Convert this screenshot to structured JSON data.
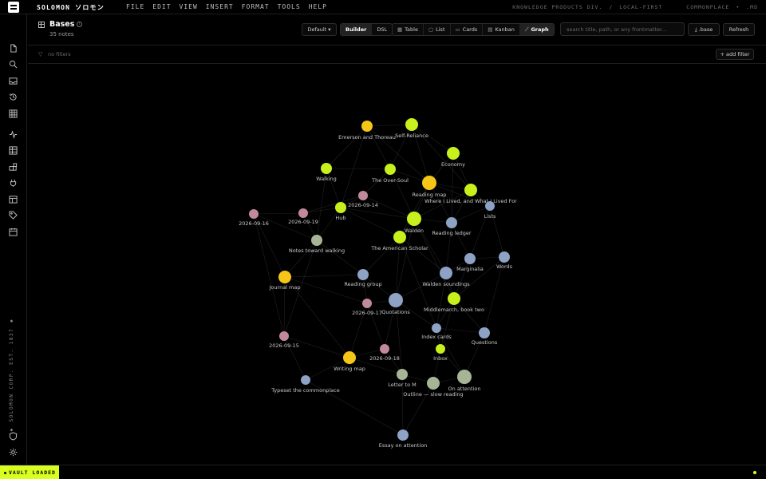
{
  "app": {
    "brand": "SOLOMON ソロモン",
    "menu": [
      "FILE",
      "EDIT",
      "VIEW",
      "INSERT",
      "FORMAT",
      "TOOLS",
      "HELP"
    ],
    "top_right": [
      "KNOWLEDGE PRODUCTS DIV.",
      "/",
      "LOCAL-FIRST",
      "COMMONPLACE",
      "•",
      ".MD"
    ],
    "rail_vertical_text": "◆ SOLOMON CORP. EST. 1837 ◆"
  },
  "rail_icons": [
    "file-icon",
    "search-icon",
    "inbox-icon",
    "history-icon",
    "grid-icon",
    "activity-icon",
    "table-icon",
    "blocks-icon",
    "plug-icon",
    "calendar-grid-icon",
    "tag-icon",
    "calendar-icon",
    "shield-icon",
    "gear-icon"
  ],
  "header": {
    "title": "Bases",
    "info_glyph": "i",
    "subtitle": "35 notes",
    "preset": "Default ▾",
    "mode_builder": "Builder",
    "mode_dsl": "DSL",
    "views": [
      {
        "glyph": "▦",
        "label": "Table"
      },
      {
        "glyph": "▢",
        "label": "List"
      },
      {
        "glyph": "▭",
        "label": "Cards"
      },
      {
        "glyph": "▤",
        "label": "Kanban"
      },
      {
        "glyph": "⟋",
        "label": "Graph"
      }
    ],
    "search_placeholder": "search title, path, or any frontmatter...",
    "base_btn": "⤓ .base",
    "refresh_btn": "Refresh"
  },
  "filters": {
    "icon": "▽",
    "text": "no filters",
    "add": "+ add filter"
  },
  "status": {
    "vault": "VAULT LOADED"
  },
  "colors": {
    "accent": "#d7ff1f",
    "lime": "#c8f01c",
    "yellow": "#f5c518",
    "pink": "#c08a9b",
    "blue": "#8da2c4",
    "sage": "#a7b596"
  },
  "graph": {
    "nodes": [
      {
        "label": "Emerson and Thoreau",
        "color": "yellow"
      },
      {
        "label": "Self-Reliance",
        "color": "lime"
      },
      {
        "label": "Economy",
        "color": "lime"
      },
      {
        "label": "Walking",
        "color": "lime"
      },
      {
        "label": "The Over-Soul",
        "color": "lime"
      },
      {
        "label": "Reading map",
        "color": "yellow"
      },
      {
        "label": "Where I Lived, and What I Lived For",
        "color": "lime"
      },
      {
        "label": "2026-09-14",
        "color": "pink"
      },
      {
        "label": "Hub",
        "color": "lime"
      },
      {
        "label": "Lists",
        "color": "blue"
      },
      {
        "label": "2026-09-16",
        "color": "pink"
      },
      {
        "label": "2026-09-19",
        "color": "pink"
      },
      {
        "label": "Walden",
        "color": "lime"
      },
      {
        "label": "Reading ledger",
        "color": "blue"
      },
      {
        "label": "Notes toward walking",
        "color": "sage"
      },
      {
        "label": "The American Scholar",
        "color": "lime"
      },
      {
        "label": "Marginalia",
        "color": "blue"
      },
      {
        "label": "Words",
        "color": "blue"
      },
      {
        "label": "Journal map",
        "color": "yellow"
      },
      {
        "label": "Reading group",
        "color": "blue"
      },
      {
        "label": "Walden soundings",
        "color": "blue"
      },
      {
        "label": "Middlemarch, book two",
        "color": "lime"
      },
      {
        "label": "2026-09-17",
        "color": "pink"
      },
      {
        "label": "Quotations",
        "color": "blue"
      },
      {
        "label": "Index cards",
        "color": "blue"
      },
      {
        "label": "Questions",
        "color": "blue"
      },
      {
        "label": "2026-09-15",
        "color": "pink"
      },
      {
        "label": "2026-09-18",
        "color": "pink"
      },
      {
        "label": "Inbox",
        "color": "lime"
      },
      {
        "label": "Writing map",
        "color": "yellow"
      },
      {
        "label": "Letter to M",
        "color": "sage"
      },
      {
        "label": "On attention",
        "color": "sage"
      },
      {
        "label": "Outline — slow reading",
        "color": "sage"
      },
      {
        "label": "Typeset the commonplace",
        "color": "blue"
      },
      {
        "label": "Essay on attention",
        "color": "blue"
      }
    ]
  }
}
